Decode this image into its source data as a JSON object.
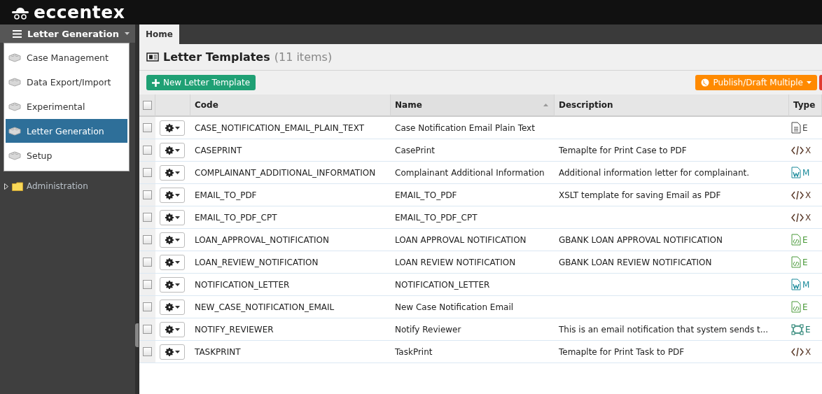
{
  "header": {
    "logo": "eccentex"
  },
  "sidebar": {
    "module_menu": {
      "label": "Letter Generation",
      "expanded": true,
      "items": [
        {
          "label": "Case Management",
          "selected": false
        },
        {
          "label": "Data Export/Import",
          "selected": false
        },
        {
          "label": "Experimental",
          "selected": false
        },
        {
          "label": "Letter Generation",
          "selected": true
        },
        {
          "label": "Setup",
          "selected": false
        }
      ]
    },
    "tree": [
      {
        "label": "Administration",
        "expanded": false
      }
    ]
  },
  "tabs": [
    {
      "label": "Home",
      "selected": true
    }
  ],
  "page": {
    "title": "Letter Templates",
    "count": "(11 items)"
  },
  "toolbar": {
    "new_button": "New Letter Template",
    "publish_button": "Publish/Draft Multiple"
  },
  "table": {
    "all_checked": false,
    "columns": [
      {
        "label": "Code",
        "sorted": false
      },
      {
        "label": "Name",
        "sorted": true
      },
      {
        "label": "Description",
        "sorted": false
      },
      {
        "label": "Type",
        "sorted": false
      }
    ],
    "rows": [
      {
        "code": "CASE_NOTIFICATION_EMAIL_PLAIN_TEXT",
        "name": "Case Notification Email Plain Text",
        "description": "",
        "type": "E",
        "kind": "text",
        "checked": false
      },
      {
        "code": "CASEPRINT",
        "name": "CasePrint",
        "description": "Temaplte for Print Case to PDF",
        "type": "X",
        "kind": "code",
        "checked": false
      },
      {
        "code": "COMPLAINANT_ADDITIONAL_INFORMATION",
        "name": "Complainant Additional Information",
        "description": "Additional information letter for complainant.",
        "type": "M",
        "kind": "word",
        "checked": false
      },
      {
        "code": "EMAIL_TO_PDF",
        "name": "EMAIL_TO_PDF",
        "description": "XSLT template for saving Email as PDF",
        "type": "X",
        "kind": "code",
        "checked": false
      },
      {
        "code": "EMAIL_TO_PDF_CPT",
        "name": "EMAIL_TO_PDF_CPT",
        "description": "",
        "type": "X",
        "kind": "code",
        "checked": false
      },
      {
        "code": "LOAN_APPROVAL_NOTIFICATION",
        "name": "LOAN APPROVAL NOTIFICATION",
        "description": "GBANK LOAN APPROVAL NOTIFICATION",
        "type": "E",
        "kind": "html",
        "checked": false
      },
      {
        "code": "LOAN_REVIEW_NOTIFICATION",
        "name": "LOAN REVIEW NOTIFICATION",
        "description": "GBANK LOAN REVIEW NOTIFICATION",
        "type": "E",
        "kind": "html",
        "checked": false
      },
      {
        "code": "NOTIFICATION_LETTER",
        "name": "NOTIFICATION_LETTER",
        "description": "",
        "type": "M",
        "kind": "word",
        "checked": false
      },
      {
        "code": "NEW_CASE_NOTIFICATION_EMAIL",
        "name": "New Case Notification Email",
        "description": "",
        "type": "E",
        "kind": "html",
        "checked": false
      },
      {
        "code": "NOTIFY_REVIEWER",
        "name": "Notify Reviewer",
        "description": "This is an email notification that system sends t...",
        "type": "E",
        "kind": "diagram",
        "checked": false
      },
      {
        "code": "TASKPRINT",
        "name": "TaskPrint",
        "description": "Temaplte for Print Task to PDF",
        "type": "X",
        "kind": "code",
        "checked": false
      }
    ]
  }
}
